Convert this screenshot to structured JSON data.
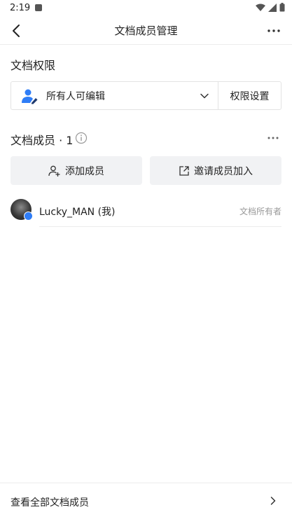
{
  "status_bar": {
    "time": "2:19"
  },
  "nav": {
    "title": "文档成员管理"
  },
  "permission": {
    "section_title": "文档权限",
    "selected": "所有人可编辑",
    "settings_label": "权限设置"
  },
  "members": {
    "section_title": "文档成员 · 1",
    "add_label": "添加成员",
    "invite_label": "邀请成员加入",
    "list": [
      {
        "name": "Lucky_MAN (我)",
        "role": "文档所有者"
      }
    ]
  },
  "footer": {
    "label": "查看全部文档成员"
  },
  "colors": {
    "accent": "#2f7df6",
    "button_bg": "#f1f2f4",
    "muted_text": "#999999"
  }
}
